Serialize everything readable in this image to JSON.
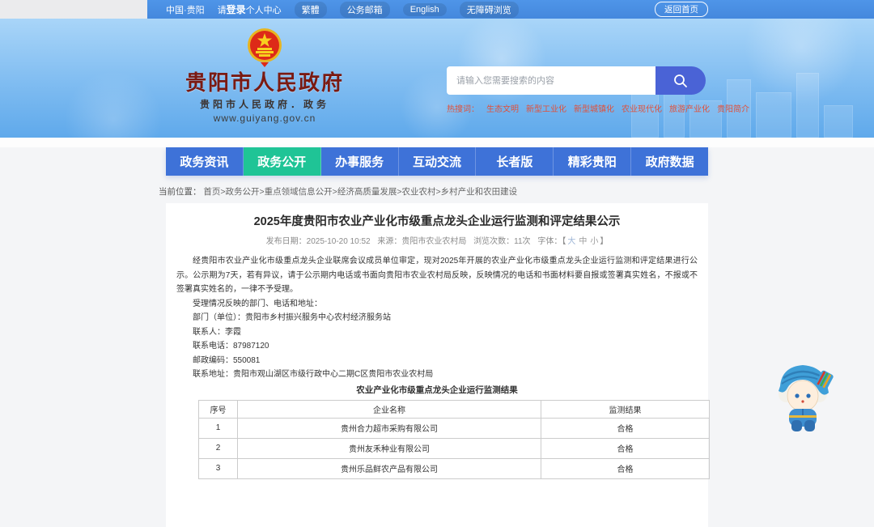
{
  "topbar": {
    "region": "中国·贵阳",
    "login_prefix": "请",
    "login_bold": "登录",
    "login_suffix": "个人中心",
    "traditional": "繁體",
    "mail": "公务邮箱",
    "english": "English",
    "accessibility": "无障碍浏览",
    "home_button": "返回首页"
  },
  "header": {
    "site_title": "贵阳市人民政府",
    "site_subtitle": "贵阳市人民政府．政务",
    "site_url": "www.guiyang.gov.cn",
    "search_placeholder": "请输入您需要搜索的内容",
    "hot_label": "热搜词：",
    "hot_words": [
      "生态文明",
      "新型工业化",
      "新型城镇化",
      "农业现代化",
      "旅游产业化",
      "贵阳简介"
    ]
  },
  "nav": {
    "items": [
      {
        "label": "政务资讯",
        "active": false
      },
      {
        "label": "政务公开",
        "active": true
      },
      {
        "label": "办事服务",
        "active": false
      },
      {
        "label": "互动交流",
        "active": false
      },
      {
        "label": "长者版",
        "active": false
      },
      {
        "label": "精彩贵阳",
        "active": false
      },
      {
        "label": "政府数据",
        "active": false
      }
    ]
  },
  "breadcrumb": {
    "label": "当前位置：",
    "path": "首页>政务公开>重点领域信息公开>经济高质量发展>农业农村>乡村产业和农田建设"
  },
  "article": {
    "title": "2025年度贵阳市农业产业化市级重点龙头企业运行监测和评定结果公示",
    "meta": {
      "publish": "发布日期：2025-10-20 10:52",
      "source": "来源：贵阳市农业农村局",
      "views": "浏览次数：11次",
      "font_label": "字体：【",
      "font_large": "大",
      "font_mid": "中",
      "font_small": "小",
      "bracket_close": "】"
    },
    "paragraphs": [
      "经贵阳市农业产业化市级重点龙头企业联席会议成员单位审定，现对2025年开展的农业产业化市级重点龙头企业运行监测和评定结果进行公示。公示期为7天，若有异议，请于公示期内电话或书面向贵阳市农业农村局反映，反映情况的电话和书面材料要自报或签署真实姓名，不报或不签署真实姓名的，一律不予受理。",
      "受理情况反映的部门、电话和地址：",
      "部门（单位）：贵阳市乡村振兴服务中心农村经济服务站",
      "联系人：李霞",
      "联系电话：87987120",
      "邮政编码：550081",
      "联系地址：贵阳市观山湖区市级行政中心二期C区贵阳市农业农村局"
    ],
    "table": {
      "caption": "农业产业化市级重点龙头企业运行监测结果",
      "headers": [
        "序号",
        "企业名称",
        "监测结果"
      ],
      "rows": [
        [
          "1",
          "贵州合力超市采购有限公司",
          "合格"
        ],
        [
          "2",
          "贵州友禾种业有限公司",
          "合格"
        ],
        [
          "3",
          "贵州乐品鲜农产品有限公司",
          "合格"
        ]
      ]
    }
  },
  "colors": {
    "topbar_blue": "#4a90e6",
    "nav_blue": "#3e72d8",
    "nav_active_green": "#1fc496",
    "search_button_indigo": "#4a63d6",
    "hot_word_red": "#e0503a",
    "site_title_maroon": "#7a1a12"
  }
}
